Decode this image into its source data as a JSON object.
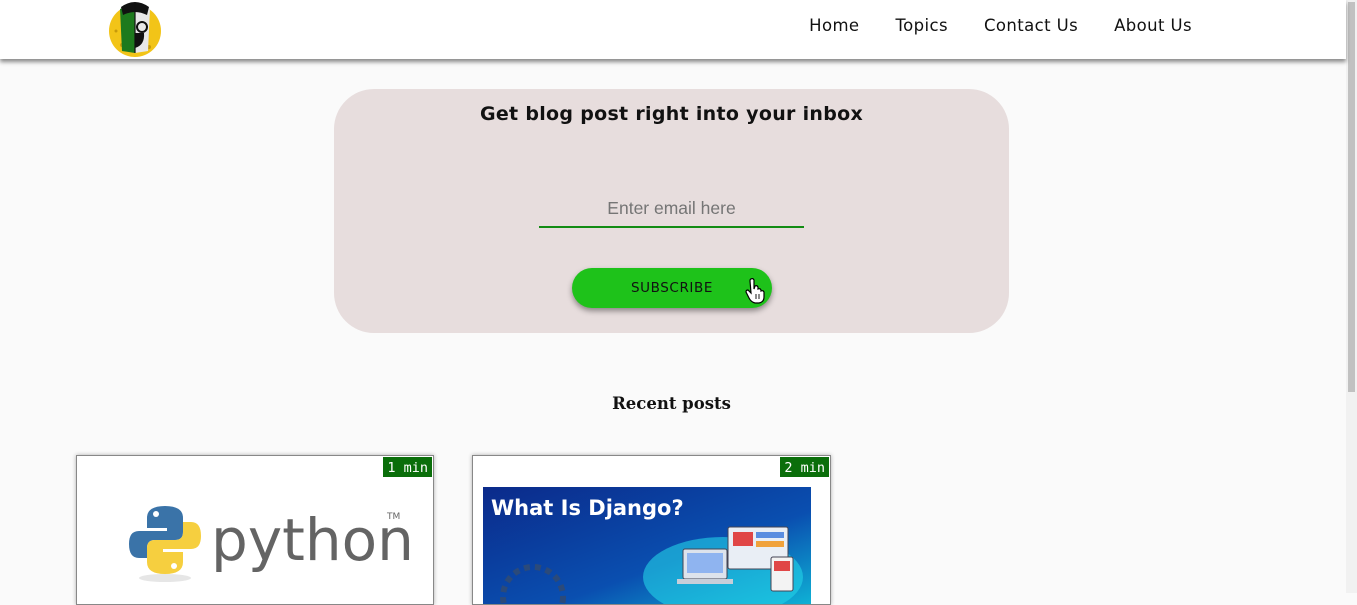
{
  "nav": {
    "items": [
      "Home",
      "Topics",
      "Contact Us",
      "About Us"
    ]
  },
  "newsletter": {
    "title": "Get blog post right into your inbox",
    "email_placeholder": "Enter email here",
    "subscribe_label": "SUBSCRIBE"
  },
  "recent": {
    "title": "Recent posts",
    "posts": [
      {
        "read_time": "1 min",
        "image_text": "python"
      },
      {
        "read_time": "2 min",
        "image_text": "What Is Django?"
      }
    ]
  },
  "colors": {
    "accent_green": "#1ec21a",
    "badge_green": "#0a6e0a",
    "underline_green": "#138c13",
    "newsletter_bg": "#e7dddd"
  },
  "icons": [
    "avatar-logo-icon",
    "hand-pointer-cursor-icon",
    "python-logo-icon",
    "laptop-devices-icon"
  ]
}
